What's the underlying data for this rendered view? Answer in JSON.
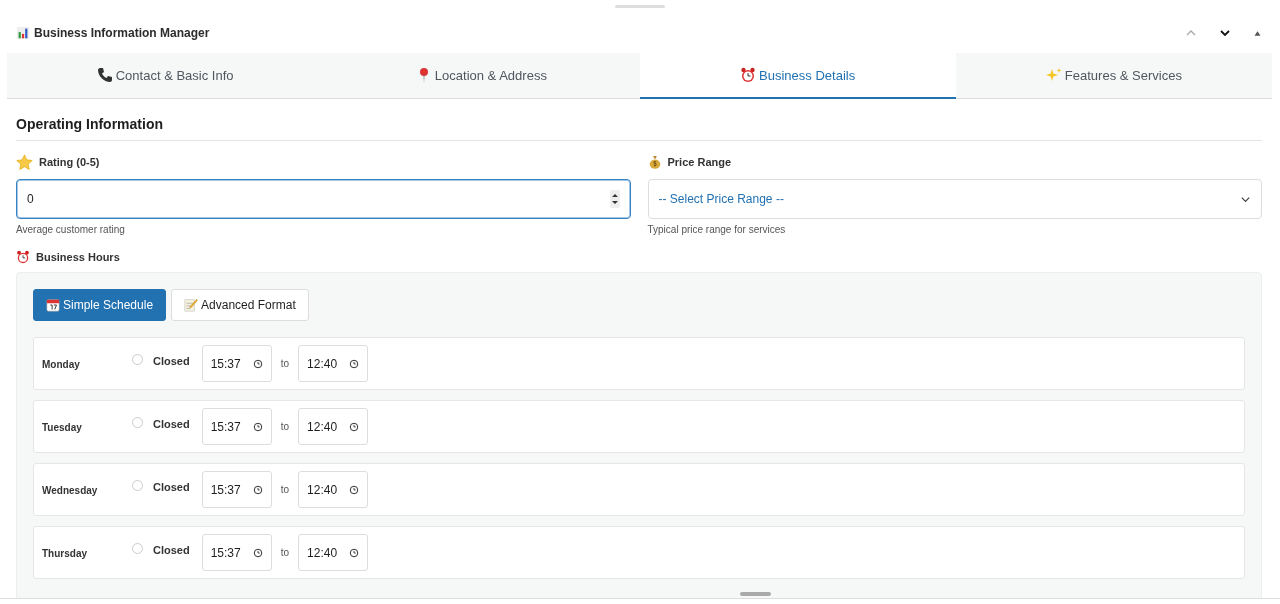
{
  "panel": {
    "title": "Business Information Manager"
  },
  "tabs": [
    {
      "label": "Contact & Basic Info",
      "selected": false
    },
    {
      "label": "Location & Address",
      "selected": false
    },
    {
      "label": "Business Details",
      "selected": true
    },
    {
      "label": "Features & Services",
      "selected": false
    }
  ],
  "section_title": "Operating Information",
  "rating": {
    "label": "Rating (0-5)",
    "value": "0",
    "help": "Average customer rating"
  },
  "price_range": {
    "label": "Price Range",
    "placeholder": "-- Select Price Range --",
    "help": "Typical price range for services"
  },
  "hours": {
    "label": "Business Hours",
    "modes": [
      {
        "label": "Simple Schedule",
        "selected": true
      },
      {
        "label": "Advanced Format",
        "selected": false
      }
    ],
    "days": [
      {
        "day": "Monday",
        "closed_label": "Closed",
        "closed": false,
        "open": "15:37",
        "to": "to",
        "close": "12:40"
      },
      {
        "day": "Tuesday",
        "closed_label": "Closed",
        "closed": false,
        "open": "15:37",
        "to": "to",
        "close": "12:40"
      },
      {
        "day": "Wednesday",
        "closed_label": "Closed",
        "closed": false,
        "open": "15:37",
        "to": "to",
        "close": "12:40"
      },
      {
        "day": "Thursday",
        "closed_label": "Closed",
        "closed": false,
        "open": "15:37",
        "to": "to",
        "close": "12:40"
      }
    ]
  }
}
